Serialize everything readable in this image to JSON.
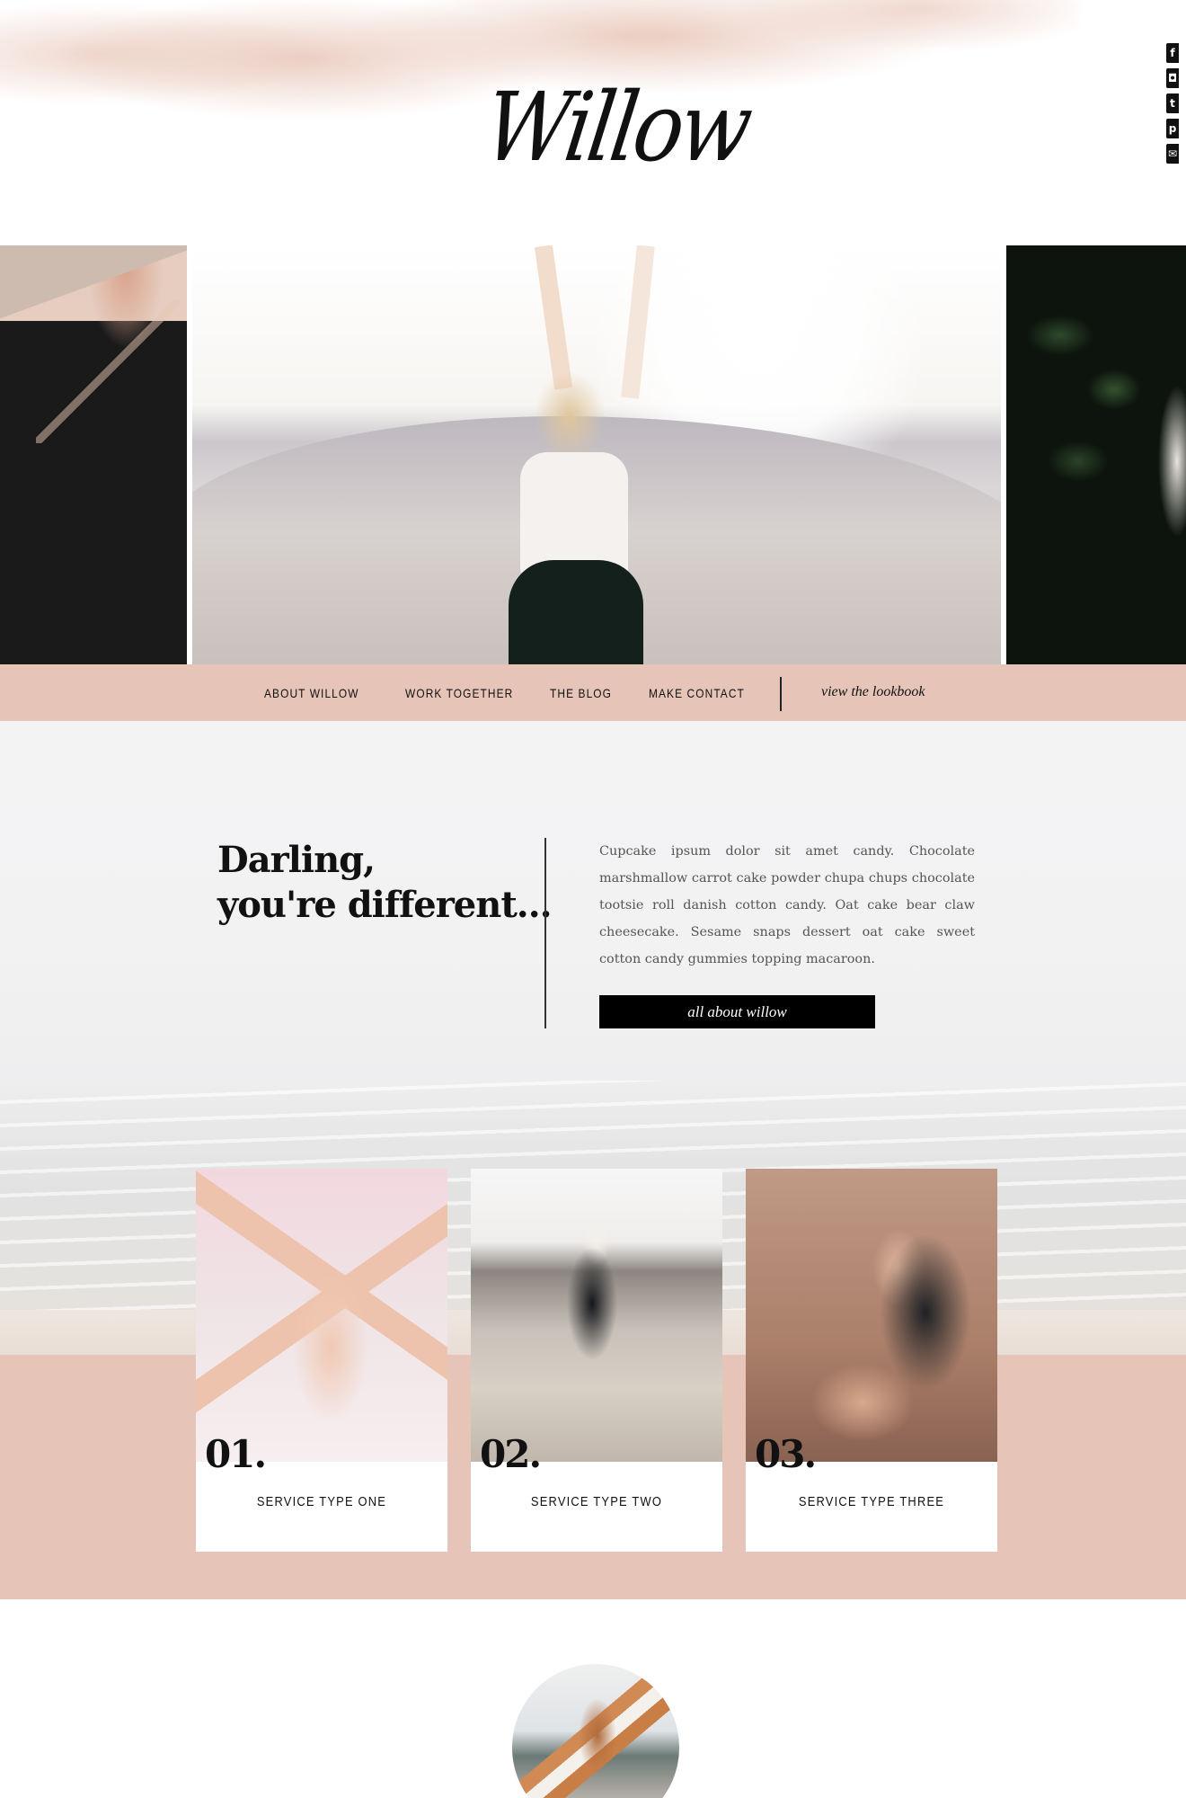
{
  "header": {
    "logo_text": "Willow",
    "social_icons": [
      "facebook-icon",
      "instagram-icon",
      "twitter-icon",
      "pinterest-icon",
      "email-icon"
    ]
  },
  "hero": {
    "photos": [
      "portrait-black-dress",
      "woman-arms-raised-dunes",
      "woman-leaves"
    ]
  },
  "nav": {
    "items": [
      {
        "label": "ABOUT WILLOW"
      },
      {
        "label": "WORK TOGETHER"
      },
      {
        "label": "THE BLOG"
      },
      {
        "label": "MAKE CONTACT"
      }
    ],
    "lookbook_label": "view the lookbook"
  },
  "intro": {
    "headline_line1": "Darling,",
    "headline_line2": "you're different...",
    "body": "Cupcake ipsum dolor sit amet candy. Chocolate marshmallow carrot cake powder chupa chups chocolate tootsie roll danish cotton candy. Oat cake bear claw cheesecake. Sesame snaps dessert oat cake sweet cotton candy gummies topping macaroon.",
    "button_label": "all about willow"
  },
  "services": [
    {
      "number": "01.",
      "label": "SERVICE TYPE ONE"
    },
    {
      "number": "02.",
      "label": "SERVICE TYPE TWO"
    },
    {
      "number": "03.",
      "label": "SERVICE TYPE THREE"
    }
  ],
  "colors": {
    "accent_pink": "#e6c4b8",
    "text_dark": "#111111",
    "button_black": "#000000"
  }
}
